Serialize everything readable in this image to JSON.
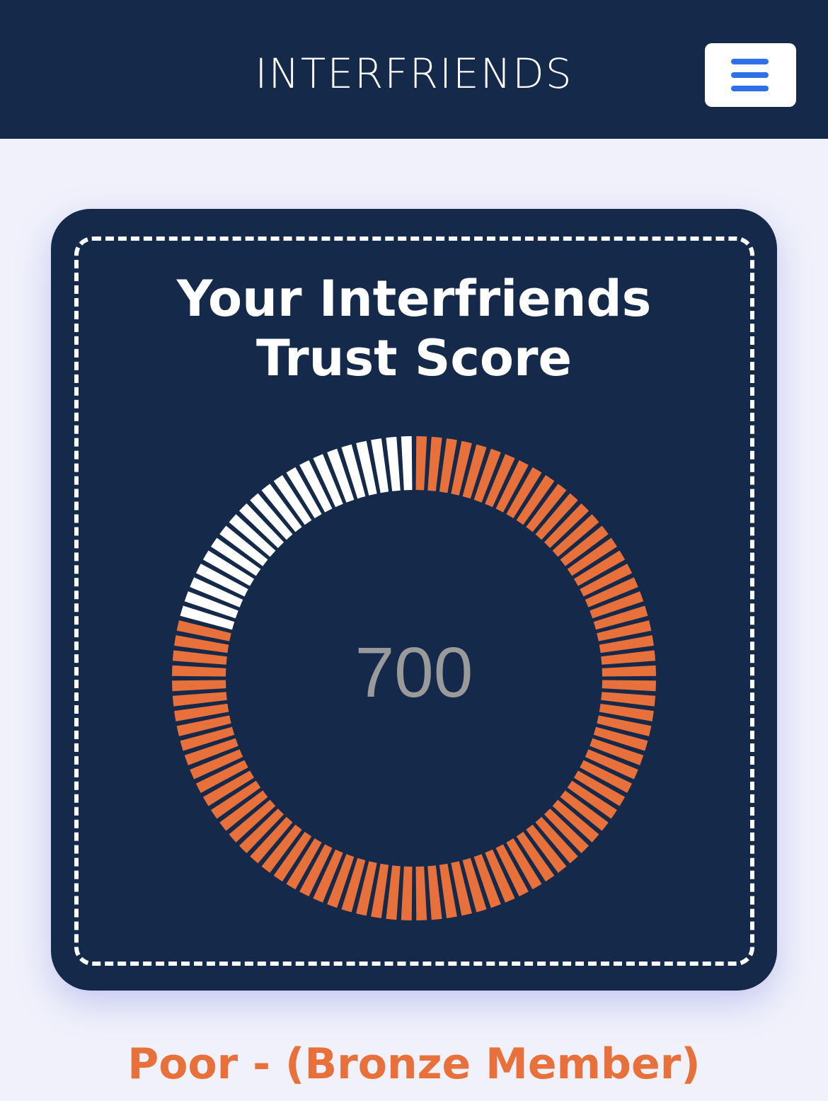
{
  "header": {
    "brand": "INTERFRIENDS",
    "menu_icon": "hamburger-menu-icon"
  },
  "card": {
    "title_line1": "Your Interfriends",
    "title_line2": "Trust Score"
  },
  "score_gauge": {
    "score": "700",
    "fill_fraction": 0.79,
    "segment_count": 100,
    "filled_color": "#e8703a",
    "empty_color": "#ffffff"
  },
  "rating": {
    "label": "Poor - (Bronze Member)"
  },
  "colors": {
    "navy": "#152a4a",
    "accent_orange": "#e8703a",
    "menu_blue": "#2f6fe8",
    "page_background": "#f0f1fb"
  }
}
